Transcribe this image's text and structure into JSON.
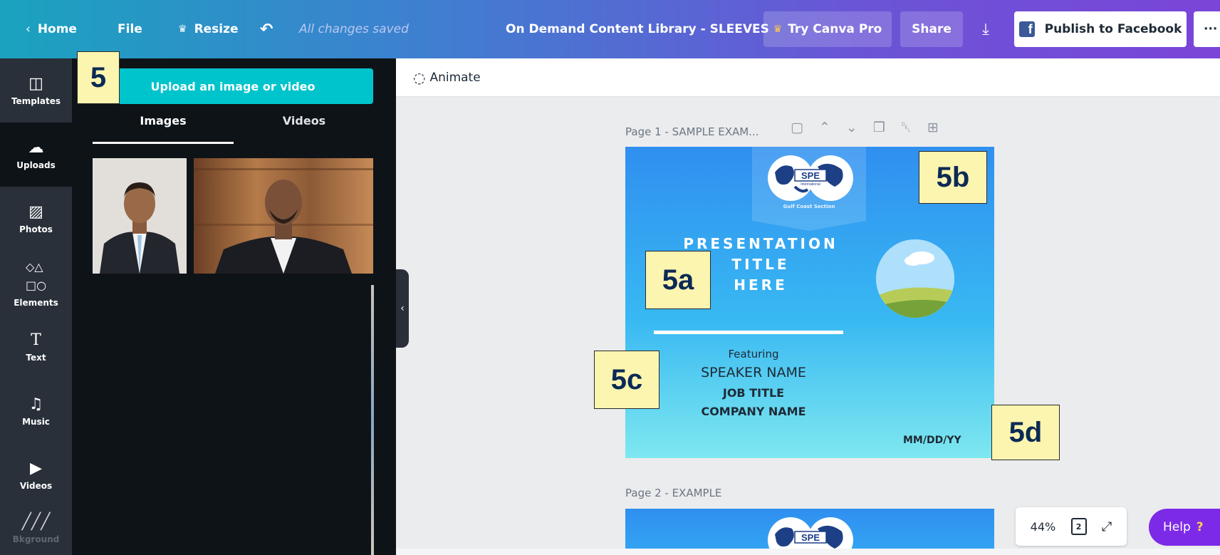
{
  "topbar": {
    "home": "Home",
    "file": "File",
    "resize": "Resize",
    "status": "All changes saved",
    "doc_title": "On Demand Content Library - SLEEVES",
    "try_pro": "Try Canva Pro",
    "share": "Share",
    "publish": "Publish to Facebook",
    "more": "···",
    "colors": {
      "gradient_start": "#1aa3bf",
      "gradient_end": "#7a45d8"
    }
  },
  "rail": {
    "items": [
      {
        "label": "Templates",
        "icon": "templates-icon"
      },
      {
        "label": "Uploads",
        "icon": "upload-cloud-icon"
      },
      {
        "label": "Photos",
        "icon": "photos-icon"
      },
      {
        "label": "Elements",
        "icon": "elements-icon"
      },
      {
        "label": "Text",
        "icon": "text-icon"
      },
      {
        "label": "Music",
        "icon": "music-icon"
      },
      {
        "label": "Videos",
        "icon": "videos-icon"
      },
      {
        "label": "Bkground",
        "icon": "background-icon"
      }
    ]
  },
  "panel": {
    "upload_button": "Upload an image or video",
    "tabs": [
      "Images",
      "Videos"
    ]
  },
  "editor": {
    "animate": "Animate",
    "page1_label": "Page 1 - SAMPLE EXAM...",
    "page2_label": "Page 2 - EXAMPLE"
  },
  "design": {
    "logo_text": "SPE",
    "logo_sub": "International",
    "gulf": "Gulf Coast Section",
    "title_lines": [
      "PRESENTATION",
      "TITLE",
      "HERE"
    ],
    "featuring": "Featuring",
    "speaker": "SPEAKER NAME",
    "job": "JOB TITLE",
    "company": "COMPANY NAME",
    "date": "MM/DD/YY"
  },
  "callouts": {
    "c5": "5",
    "c5a": "5a",
    "c5b": "5b",
    "c5c": "5c",
    "c5d": "5d"
  },
  "zoom": {
    "level": "44%",
    "pages": "2"
  },
  "help": {
    "label": "Help",
    "mark": "?"
  }
}
